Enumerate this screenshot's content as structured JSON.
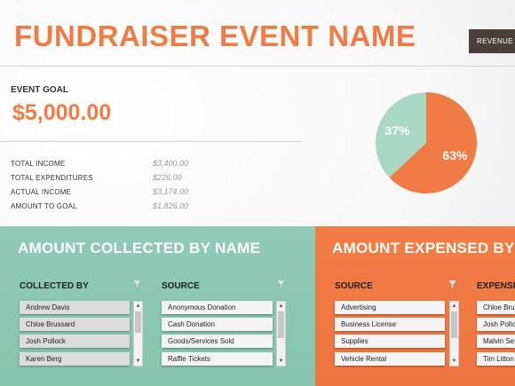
{
  "header": {
    "title": "FUNDRAISER EVENT NAME",
    "revenue_tab": "REVENUE"
  },
  "goal": {
    "label": "EVENT GOAL",
    "value": "$5,000.00"
  },
  "summary": [
    {
      "label": "TOTAL INCOME",
      "value": "$3,400.00"
    },
    {
      "label": "TOTAL EXPENDITURES",
      "value": "$226.00"
    },
    {
      "label": "ACTUAL INCOME",
      "value": "$3,174.00"
    },
    {
      "label": "AMOUNT TO GOAL",
      "value": "$1,826.00"
    }
  ],
  "chart_data": {
    "type": "pie",
    "slices": [
      {
        "label": "63%",
        "value": 63,
        "color": "#f07c45"
      },
      {
        "label": "37%",
        "value": 37,
        "color": "#a9d8c5"
      }
    ]
  },
  "collected": {
    "title": "AMOUNT COLLECTED BY NAME",
    "by_header": "COLLECTED BY",
    "source_header": "SOURCE",
    "names": [
      "Andrew Davis",
      "Chloe Brussard",
      "Josh Pollock",
      "Karen Berg"
    ],
    "sources": [
      "Anonymous Donation",
      "Cash Donation",
      "Goods/Services Sold",
      "Raffle Tickets"
    ]
  },
  "expensed": {
    "title": "AMOUNT EXPENSED BY",
    "source_header": "SOURCE",
    "by_header": "EXPENSED",
    "sources": [
      "Advertising",
      "Business License",
      "Supplies",
      "Vehicle Rental"
    ],
    "names": [
      "Chloe Brussard",
      "Josh Pollock",
      "Malvin Se",
      "Tim Litton"
    ]
  },
  "colors": {
    "accent": "#f07c45",
    "mint": "#8cc9b4",
    "dark": "#4a3f3a"
  }
}
